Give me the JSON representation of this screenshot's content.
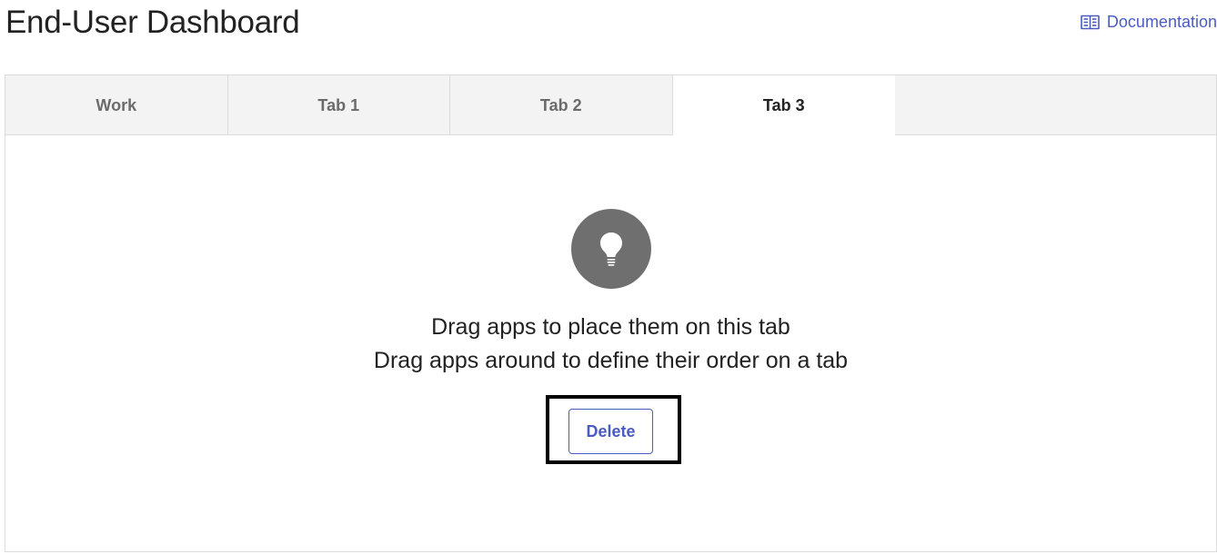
{
  "header": {
    "title": "End-User Dashboard",
    "documentation_label": "Documentation"
  },
  "tabs": [
    {
      "label": "Work",
      "active": false
    },
    {
      "label": "Tab 1",
      "active": false
    },
    {
      "label": "Tab 2",
      "active": false
    },
    {
      "label": "Tab 3",
      "active": true
    }
  ],
  "empty_state": {
    "icon": "lightbulb-icon",
    "line1": "Drag apps to place them on this tab",
    "line2": "Drag apps around to define their order on a tab",
    "delete_label": "Delete"
  },
  "colors": {
    "accent": "#4a5cc4",
    "icon_circle": "#6f6f6f",
    "tab_bar_bg": "#f3f3f3",
    "focus_outline": "#000000"
  }
}
